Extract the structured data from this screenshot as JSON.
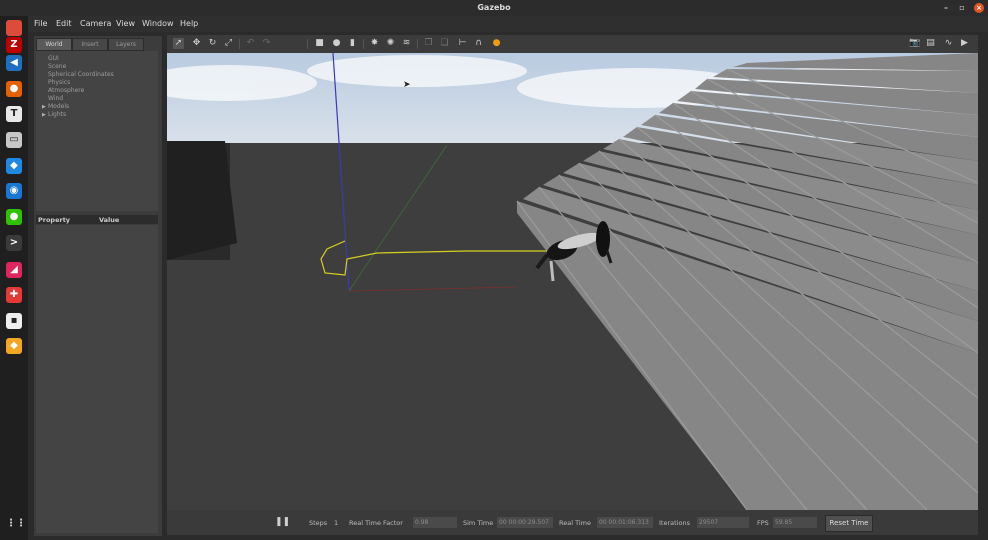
{
  "window": {
    "title": "Gazebo",
    "controls": {
      "minimize": "–",
      "maximize": "▫",
      "close": "×"
    }
  },
  "dock": [
    {
      "name": "chrome",
      "glyph": "",
      "color": "#dd4b39"
    },
    {
      "name": "filezilla",
      "glyph": "Z",
      "color": "#bf0000"
    },
    {
      "name": "vscode",
      "glyph": "◀",
      "color": "#1e6fbf"
    },
    {
      "name": "firefox",
      "glyph": "●",
      "color": "#e66000"
    },
    {
      "name": "typora",
      "glyph": "T",
      "color": "#e8e8e8"
    },
    {
      "name": "files",
      "glyph": "▭",
      "color": "#c8c8c8"
    },
    {
      "name": "remote",
      "glyph": "◆",
      "color": "#1e88e5"
    },
    {
      "name": "thunderbird",
      "glyph": "◉",
      "color": "#1976d2"
    },
    {
      "name": "wechat",
      "glyph": "●",
      "color": "#2dc100"
    },
    {
      "name": "terminal",
      "glyph": ">",
      "color": "#3a3a3a"
    },
    {
      "name": "xmind",
      "glyph": "◢",
      "color": "#e0245e"
    },
    {
      "name": "pycharm",
      "glyph": "✚",
      "color": "#e53935"
    },
    {
      "name": "notes",
      "glyph": "▪",
      "color": "#eeeeee"
    },
    {
      "name": "gazebo",
      "glyph": "◆",
      "color": "#f5a623"
    }
  ],
  "menu": [
    "File",
    "Edit",
    "Camera",
    "View",
    "Window",
    "Help"
  ],
  "left_panel": {
    "tabs": [
      "World",
      "Insert",
      "Layers"
    ],
    "tree": [
      "GUI",
      "Scene",
      "Spherical Coordinates",
      "Physics",
      "Atmosphere",
      "Wind",
      "Models",
      "Lights"
    ],
    "expandable": [
      "Models",
      "Lights"
    ],
    "properties_header": {
      "property": "Property",
      "value": "Value"
    }
  },
  "toolbar": {
    "left_icons": [
      "select-arrow",
      "translate",
      "rotate",
      "scale",
      "undo",
      "redo",
      "box",
      "sphere",
      "cylinder",
      "point-light",
      "spot-light",
      "directional-light",
      "copy",
      "paste",
      "align",
      "snap",
      "orange-joint"
    ],
    "right_icons": [
      "screenshot",
      "log",
      "plot",
      "record"
    ]
  },
  "bottom_bar": {
    "pause_glyph": "❚❚",
    "steps_label": "Steps",
    "steps_value": "1",
    "real_time_factor_label": "Real Time Factor",
    "real_time_factor_value": "0.98",
    "sim_time_label": "Sim Time",
    "sim_time_value": "00 00:00:29.507",
    "real_time_label": "Real Time",
    "real_time_value": "00 00:01:06.313",
    "iterations_label": "Iterations",
    "iterations_value": "29507",
    "fps_label": "FPS",
    "fps_value": "59.85",
    "reset_label": "Reset Time"
  }
}
